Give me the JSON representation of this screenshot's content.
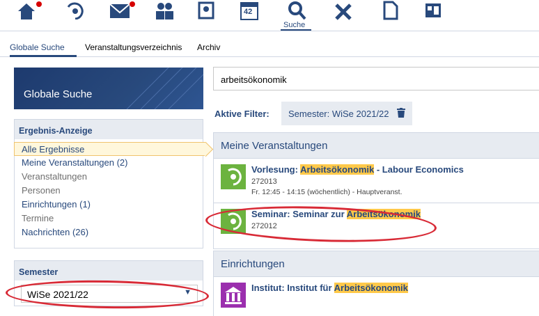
{
  "topnav": {
    "icons": [
      "home-icon",
      "activity-icon",
      "mail-icon",
      "community-icon",
      "profile-icon",
      "calendar-icon",
      "search-icon",
      "tools-icon",
      "files-icon",
      "admin-icon"
    ],
    "calendar_number": "42",
    "active_label": "Suche"
  },
  "subnav": {
    "items": [
      "Globale Suche",
      "Veranstaltungsverzeichnis",
      "Archiv"
    ]
  },
  "sidebar": {
    "banner_title": "Globale Suche",
    "results_heading": "Ergebnis-Anzeige",
    "results": [
      "Alle Ergebnisse",
      "Meine Veranstaltungen (2)",
      "Veranstaltungen",
      "Personen",
      "Einrichtungen (1)",
      "Termine",
      "Nachrichten (26)"
    ],
    "semester_heading": "Semester",
    "semester_value": "WiSe 2021/22"
  },
  "main": {
    "search_value": "arbeitsökonomik",
    "filter_label": "Aktive Filter:",
    "filter_chip": "Semester: WiSe 2021/22",
    "sections": [
      {
        "heading": "Meine Veranstaltungen",
        "rows": [
          {
            "prefix": "Vorlesung: ",
            "highlight": "Arbeitsökonomik",
            "suffix": " - Labour Economics",
            "number": "272013",
            "meta": "Fr. 12:45 - 14:15 (wöchentlich) - Hauptveranst."
          },
          {
            "prefix": "Seminar: Seminar zur ",
            "highlight": "Arbeitsökonomik",
            "suffix": "",
            "number": "272012",
            "meta": ""
          }
        ]
      },
      {
        "heading": "Einrichtungen",
        "rows": [
          {
            "prefix": "Institut: Institut für ",
            "highlight": "Arbeitsökonomik",
            "suffix": "",
            "number": "",
            "meta": ""
          }
        ]
      }
    ]
  },
  "colors": {
    "brand": "#28497c",
    "highlight": "#ffc94a",
    "annotation": "#d82a36",
    "course_icon": "#6cb33f",
    "institute_icon": "#9b2fae"
  }
}
